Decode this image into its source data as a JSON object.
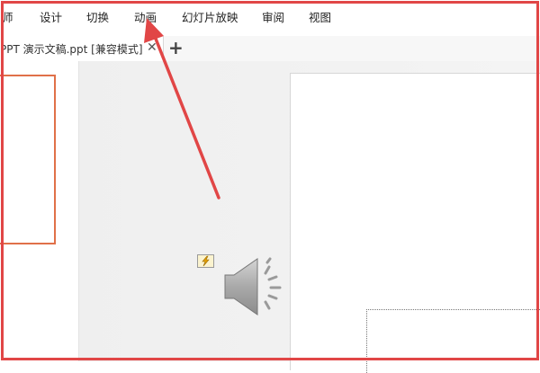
{
  "menu": {
    "items": [
      {
        "label": "设计"
      },
      {
        "label": "切换"
      },
      {
        "label": "动画"
      },
      {
        "label": "幻灯片放映"
      },
      {
        "label": "审阅"
      },
      {
        "label": "视图"
      }
    ],
    "partial_left_label": "师"
  },
  "tabbar": {
    "doc_title": "PPT 演示文稿.ppt [兼容模式]",
    "close_glyph": "✕",
    "add_glyph": "+"
  },
  "colors": {
    "annotation": "#e14646",
    "selection": "#e07049"
  },
  "icons": {
    "animation_badge": "lightning-icon",
    "audio": "speaker-icon"
  }
}
